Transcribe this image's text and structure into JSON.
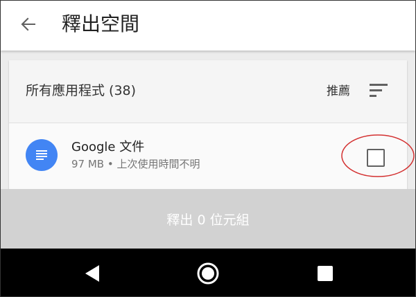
{
  "appbar": {
    "title": "釋出空間"
  },
  "list": {
    "header": "所有應用程式 (38)",
    "sort_label": "推薦",
    "items": [
      {
        "name": "Google 文件",
        "details": "97 MB • 上次使用時間不明",
        "icon": "docs-icon",
        "checked": false
      }
    ]
  },
  "action": {
    "label": "釋出 0 位元組"
  },
  "colors": {
    "docs_blue": "#4285f4",
    "annotation_red": "#d32f2f",
    "action_bg": "#d2d2d2"
  },
  "navigation": {
    "back": "back-triangle-icon",
    "home": "home-circle-icon",
    "recents": "recents-square-icon"
  }
}
